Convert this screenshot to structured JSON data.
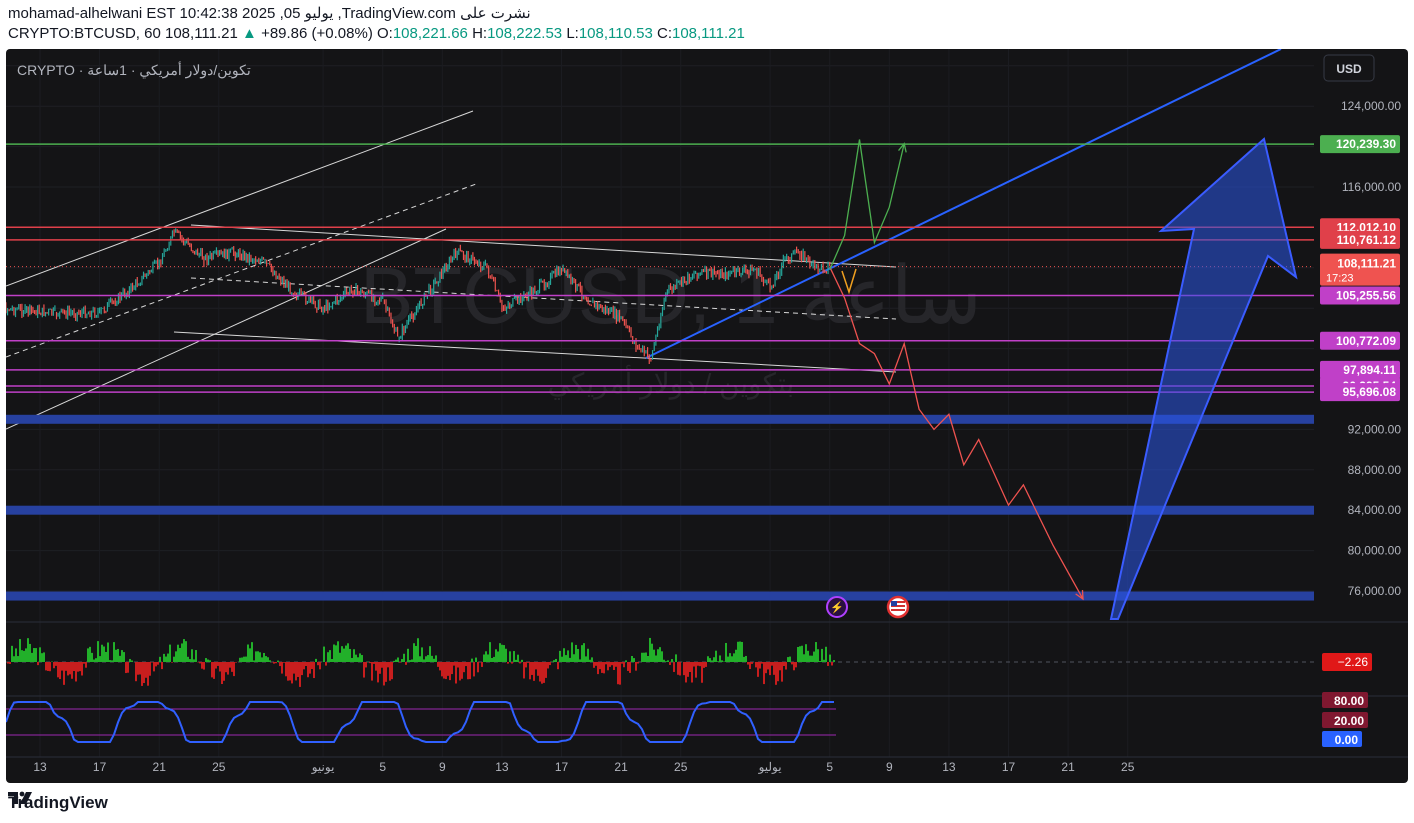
{
  "header": {
    "line1": "mohamad-alhelwani EST 10:42:38 2025 ,05 يوليو ,TradingView.com نشرت على",
    "symbol": "CRYPTO:BTCUSD, 60",
    "last": "108,111.21",
    "change": "+89.86 (+0.08%)",
    "o_label": "O:",
    "o": "108,221.66",
    "h_label": "H:",
    "h": "108,222.53",
    "l_label": "L:",
    "l": "108,110.53",
    "c_label": "C:",
    "c": "108,111.21"
  },
  "legend": "CRYPTO · تكوين/دولار أمريكي · 1ساعة",
  "watermark": {
    "line1": "BTCUSD, 1 ساعة",
    "line2": "بتكوين / دولار أمريكي"
  },
  "currency_button": "USD",
  "footer": {
    "brand": "TradingView"
  },
  "colors": {
    "background": "#141416",
    "up": "#26a69a",
    "down": "#ef5350",
    "accent_blue": "#2962ff",
    "support_band": "#2741a0",
    "magenta": "#c040c8",
    "green_level": "#4caf50",
    "red_level": "#e0404a"
  },
  "chart_data": {
    "type": "line",
    "symbol": "CRYPTO:BTCUSD",
    "interval": "60",
    "ylim": [
      72000,
      128000
    ],
    "y_ticks": [
      "124,000.00",
      "116,000.00",
      "92,000.00",
      "88,000.00",
      "84,000.00",
      "80,000.00",
      "76,000.00"
    ],
    "x_ticks": [
      "13",
      "17",
      "21",
      "25",
      "يونيو",
      "5",
      "9",
      "13",
      "17",
      "21",
      "25",
      "يوليو",
      "5",
      "9",
      "13",
      "17",
      "21",
      "25"
    ],
    "price_path": [
      {
        "x": "May 09",
        "y": 104200
      },
      {
        "x": "May 12",
        "y": 103800
      },
      {
        "x": "May 14",
        "y": 103500
      },
      {
        "x": "May 17",
        "y": 103600
      },
      {
        "x": "May 19",
        "y": 105800
      },
      {
        "x": "May 21",
        "y": 108500
      },
      {
        "x": "May 22",
        "y": 111500
      },
      {
        "x": "May 24",
        "y": 108900
      },
      {
        "x": "May 26",
        "y": 109500
      },
      {
        "x": "May 28",
        "y": 108600
      },
      {
        "x": "May 30",
        "y": 105600
      },
      {
        "x": "Jun 01",
        "y": 104000
      },
      {
        "x": "Jun 03",
        "y": 105800
      },
      {
        "x": "Jun 05",
        "y": 104800
      },
      {
        "x": "Jun 06",
        "y": 101000
      },
      {
        "x": "Jun 08",
        "y": 105500
      },
      {
        "x": "Jun 10",
        "y": 109600
      },
      {
        "x": "Jun 12",
        "y": 108000
      },
      {
        "x": "Jun 13",
        "y": 104000
      },
      {
        "x": "Jun 15",
        "y": 105500
      },
      {
        "x": "Jun 17",
        "y": 107800
      },
      {
        "x": "Jun 19",
        "y": 104500
      },
      {
        "x": "Jun 21",
        "y": 103000
      },
      {
        "x": "Jun 22",
        "y": 100300
      },
      {
        "x": "Jun 23",
        "y": 99000
      },
      {
        "x": "Jun 24",
        "y": 105500
      },
      {
        "x": "Jun 26",
        "y": 107500
      },
      {
        "x": "Jun 28",
        "y": 107400
      },
      {
        "x": "Jun 30",
        "y": 107800
      },
      {
        "x": "Jul 01",
        "y": 106000
      },
      {
        "x": "Jul 02",
        "y": 108900
      },
      {
        "x": "Jul 03",
        "y": 109500
      },
      {
        "x": "Jul 04",
        "y": 108000
      },
      {
        "x": "Jul 05",
        "y": 108111
      }
    ],
    "horizontal_levels": [
      {
        "label": "120,239.30",
        "value": 120239.3,
        "color": "#4caf50"
      },
      {
        "label": "112,012.10",
        "value": 112012.1,
        "color": "#e0404a"
      },
      {
        "label": "110,761.12",
        "value": 110761.12,
        "color": "#e0404a"
      },
      {
        "label": "105,255.56",
        "value": 105255.56,
        "color": "#c040c8"
      },
      {
        "label": "100,772.09",
        "value": 100772.09,
        "color": "#c040c8"
      },
      {
        "label": "97,894.11",
        "value": 97894.11,
        "color": "#c040c8"
      },
      {
        "label": "96,295.54",
        "value": 96295.54,
        "color": "#c040c8"
      },
      {
        "label": "95,696.08",
        "value": 95696.08,
        "color": "#c040c8"
      }
    ],
    "last_price": {
      "label": "108,111.21",
      "countdown": "17:23",
      "value": 108111.21
    },
    "support_bands": [
      93000,
      84000,
      75500
    ],
    "projection_bearish": [
      {
        "x": "Jul 05",
        "y": 108100
      },
      {
        "x": "Jul 06",
        "y": 105000
      },
      {
        "x": "Jul 07",
        "y": 100500
      },
      {
        "x": "Jul 08",
        "y": 99500
      },
      {
        "x": "Jul 09",
        "y": 96500
      },
      {
        "x": "Jul 10",
        "y": 100500
      },
      {
        "x": "Jul 11",
        "y": 94000
      },
      {
        "x": "Jul 12",
        "y": 92000
      },
      {
        "x": "Jul 13",
        "y": 93500
      },
      {
        "x": "Jul 14",
        "y": 88500
      },
      {
        "x": "Jul 15",
        "y": 91000
      },
      {
        "x": "Jul 17",
        "y": 84500
      },
      {
        "x": "Jul 18",
        "y": 86500
      },
      {
        "x": "Jul 20",
        "y": 80500
      },
      {
        "x": "Jul 22",
        "y": 75200
      }
    ],
    "projection_bullish": [
      {
        "x": "Jul 05",
        "y": 107800
      },
      {
        "x": "Jul 06",
        "y": 111200
      },
      {
        "x": "Jul 07",
        "y": 120700
      },
      {
        "x": "Jul 08",
        "y": 110500
      },
      {
        "x": "Jul 09",
        "y": 114000
      },
      {
        "x": "Jul 10",
        "y": 120300
      }
    ],
    "oscillator": {
      "last_label": "−2.26",
      "last_value": -2.26
    },
    "stochastic": {
      "levels": [
        "80.00",
        "20.00"
      ],
      "last_label": "0.00",
      "last_value": 0
    }
  }
}
